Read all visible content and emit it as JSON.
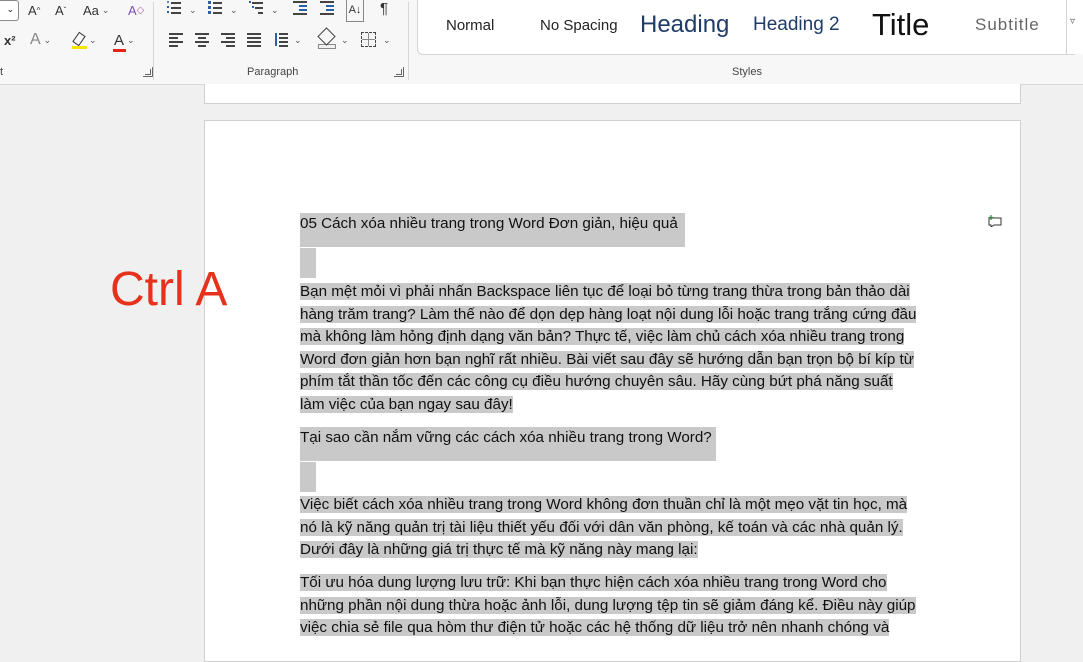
{
  "ribbon": {
    "font_grow_label": "A",
    "font_shrink_label": "A",
    "change_case_label": "Aa",
    "superscript_label": "x²",
    "font_color_label": "A",
    "font_group_label": "t",
    "paragraph_group_label": "Paragraph",
    "styles_group_label": "Styles",
    "sort_label": "A↓",
    "pilcrow_label": "¶"
  },
  "styles": [
    {
      "label": "Normal"
    },
    {
      "label": "No Spacing"
    },
    {
      "label": "Heading"
    },
    {
      "label": "Heading 2"
    },
    {
      "label": "Title"
    },
    {
      "label": "Subtitle"
    }
  ],
  "overlay_label": "Ctrl A",
  "document": {
    "title_line": "05 Cách xóa nhiều trang trong Word Đơn giản, hiệu quả",
    "para1": [
      "Bạn mệt mỏi vì phải nhấn Backspace liên tục để loại bỏ từng trang thừa trong bản thảo dài",
      "hàng trăm trang? Làm thế nào để dọn dẹp hàng loạt nội dung lỗi hoặc trang trắng cứng đầu",
      "mà không làm hỏng định dạng văn bản? Thực tế, việc làm chủ cách xóa nhiều trang trong",
      "Word đơn giản hơn bạn nghĩ rất nhiều. Bài viết sau đây sẽ hướng dẫn bạn trọn bộ bí kíp từ",
      "phím tắt thần tốc đến các công cụ điều hướng chuyên sâu. Hãy cùng bứt phá năng suất",
      "làm việc của bạn ngay sau đây!"
    ],
    "heading2": "Tại sao cần nắm vững các cách xóa nhiều trang trong Word?",
    "para2": [
      "Việc biết cách xóa nhiều trang trong Word không đơn thuần chỉ là một mẹo vặt tin học, mà",
      "nó là kỹ năng quản trị tài liệu thiết yếu đối với dân văn phòng, kế toán và các nhà quản lý.",
      "Dưới đây là những giá trị thực tế mà kỹ năng này mang lại:"
    ],
    "para3": [
      "Tối ưu hóa dung lượng lưu trữ: Khi bạn thực hiện cách xóa nhiều trang trong Word cho",
      "những phần nội dung thừa hoặc ảnh lỗi, dung lượng tệp tin sẽ giảm đáng kể. Điều này giúp",
      "việc chia sẻ file qua hòm thư điện tử hoặc các hệ thống dữ liệu trở nên nhanh chóng và"
    ]
  }
}
